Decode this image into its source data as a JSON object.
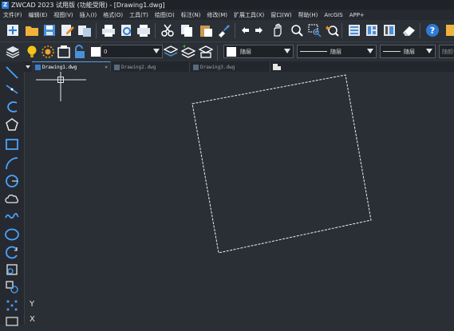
{
  "app": {
    "title": "ZWCAD 2023 试用版 (功能受限) - [Drawing1.dwg]",
    "logo_letter": "Z"
  },
  "menu": {
    "items": [
      "文件(F)",
      "编辑(E)",
      "视图(V)",
      "插入(I)",
      "格式(O)",
      "工具(T)",
      "绘图(D)",
      "标注(N)",
      "修改(M)",
      "扩展工具(X)",
      "窗口(W)",
      "帮助(H)",
      "ArcGIS",
      "APP+"
    ]
  },
  "toolbar2": {
    "layer_value": "0",
    "linetype_value": "ByLayer",
    "lineweight_value": "ByLayer",
    "color_value": "ByLayer",
    "linetype_label": "随层",
    "lineweight_label": "随层",
    "color_label": "随层",
    "extra_label": "随颜色"
  },
  "tabs": [
    {
      "label": "Drawing1.dwg",
      "active": true,
      "close": "×"
    },
    {
      "label": "Drawing2.dwg",
      "active": false
    },
    {
      "label": "Drawing3.dwg",
      "active": false
    }
  ],
  "canvas": {
    "ucs_y_label": "Y",
    "ucs_x_label": "X"
  },
  "colors": {
    "background": "#2a2e35",
    "accent": "#3c7ccc",
    "drawing_line": "#f0f0f0"
  }
}
